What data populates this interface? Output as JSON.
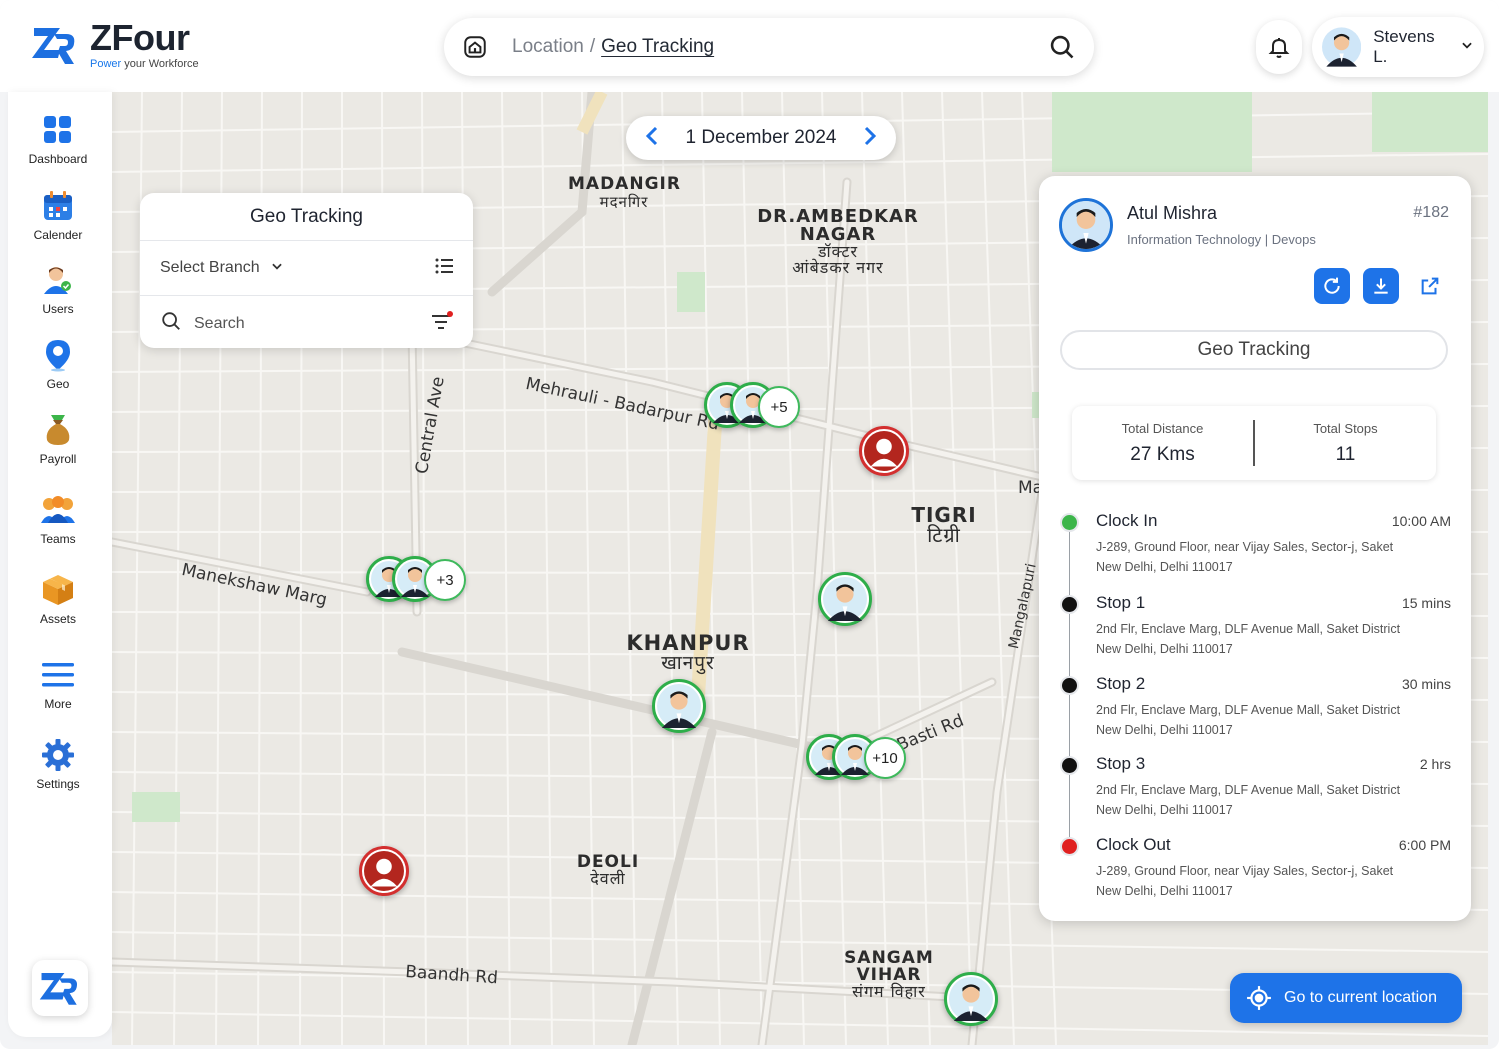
{
  "app": {
    "name": "ZFour",
    "tagline_brand": "Power",
    "tagline_rest": "your Workforce"
  },
  "breadcrumb": {
    "parent": "Location",
    "separator": "/",
    "current": "Geo Tracking"
  },
  "user": {
    "name": "Stevens L."
  },
  "sidebar": {
    "items": [
      {
        "label": "Dashboard",
        "icon": "dashboard-icon"
      },
      {
        "label": "Calender",
        "icon": "calendar-icon"
      },
      {
        "label": "Users",
        "icon": "users-icon"
      },
      {
        "label": "Geo",
        "icon": "location-pin-icon"
      },
      {
        "label": "Payroll",
        "icon": "money-bag-icon"
      },
      {
        "label": "Teams",
        "icon": "teams-icon"
      },
      {
        "label": "Assets",
        "icon": "box-icon"
      },
      {
        "label": "More",
        "icon": "menu-icon"
      },
      {
        "label": "Settings",
        "icon": "gear-icon"
      }
    ]
  },
  "date_nav": {
    "date": "1 December 2024"
  },
  "geo_card": {
    "title": "Geo Tracking",
    "branch_placeholder": "Select Branch",
    "search_placeholder": "Search"
  },
  "map": {
    "places": [
      {
        "en": "MADANGIR",
        "hi": "मदनगिर"
      },
      {
        "en": "DR.AMBEDKAR",
        "en2": "NAGAR",
        "hi": "डॉक्टर",
        "hi2": "आंबेडकर नगर"
      },
      {
        "en": "TIGRI",
        "hi": "टिग्री"
      },
      {
        "en": "KHANPUR",
        "hi": "खानपुर"
      },
      {
        "en": "DEOLI",
        "hi": "देवली"
      },
      {
        "en": "SANGAM VIHAR",
        "hi": "संगम विहार"
      }
    ],
    "roads": [
      "Mehrauli - Badarpur Rd",
      "Central Ave",
      "Manekshaw Marg",
      "Basti Rd",
      "Baandh Rd",
      "Mangalapuri",
      "Ma"
    ],
    "clusters": [
      "+5",
      "+3",
      "+10"
    ]
  },
  "panel": {
    "name": "Atul Mishra",
    "department": "Information Technology | Devops",
    "id": "#182",
    "geo_button": "Geo Tracking",
    "stats": [
      {
        "label": "Total Distance",
        "value": "27 Kms"
      },
      {
        "label": "Total Stops",
        "value": "11"
      }
    ],
    "timeline": [
      {
        "title": "Clock In",
        "time": "10:00 AM",
        "addr1": "J-289, Ground Floor, near Vijay Sales, Sector-j, Saket",
        "addr2": "New Delhi, Delhi 110017",
        "color": "#3cb54a"
      },
      {
        "title": "Stop 1",
        "time": "15 mins",
        "addr1": "2nd Flr, Enclave Marg, DLF Avenue Mall, Saket District",
        "addr2": "New Delhi, Delhi 110017",
        "color": "#111111"
      },
      {
        "title": "Stop 2",
        "time": "30 mins",
        "addr1": "2nd Flr, Enclave Marg, DLF Avenue Mall, Saket District",
        "addr2": "New Delhi, Delhi 110017",
        "color": "#111111"
      },
      {
        "title": "Stop 3",
        "time": "2 hrs",
        "addr1": "2nd Flr, Enclave Marg, DLF Avenue Mall, Saket District",
        "addr2": "New Delhi, Delhi 110017",
        "color": "#111111"
      },
      {
        "title": "Clock Out",
        "time": "6:00 PM",
        "addr1": "J-289, Ground Floor, near Vijay Sales, Sector-j, Saket",
        "addr2": "New Delhi, Delhi 110017",
        "color": "#e02020"
      }
    ]
  },
  "goto_button": {
    "label": "Go to current location"
  },
  "colors": {
    "accent": "#1e73e8",
    "active": "#2eae4a",
    "inactive": "#d32f2f"
  }
}
